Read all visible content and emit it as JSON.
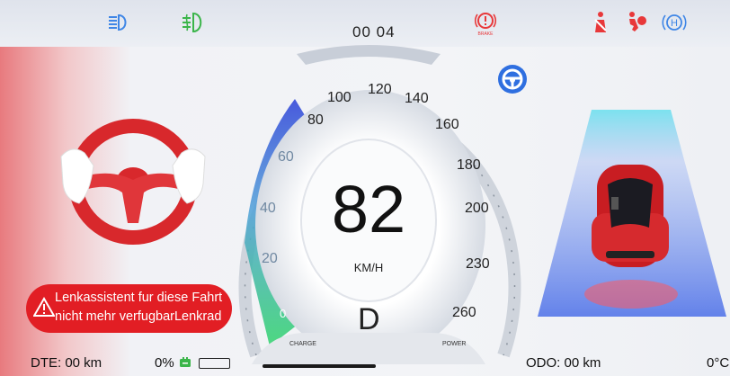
{
  "top_bar": {
    "clock": "00 04",
    "icons": [
      "low-beam-icon",
      "fog-light-icon",
      "brake-warning-icon",
      "seatbelt-warning-icon",
      "airbag-warning-icon",
      "hold-icon"
    ],
    "brake_label": "BRAKE",
    "hold_label": "H"
  },
  "speedometer": {
    "speed": "82",
    "unit": "KM/H",
    "gear": "D",
    "charge_label": "CHARGE",
    "power_label": "POWER",
    "ticks": [
      "0",
      "20",
      "40",
      "60",
      "80",
      "100",
      "120",
      "140",
      "160",
      "180",
      "200",
      "230",
      "260"
    ]
  },
  "steering_icon": "steering-wheel-icon",
  "warning": {
    "text": "Lenkassistent fur diese Fahrt\nnicht mehr verfugbarLenkrad",
    "icon": "warning-triangle-icon"
  },
  "bottom": {
    "dte": "DTE: 00 km",
    "battery_pct": "0%",
    "battery_fill": 0,
    "odo": "ODO: 00 km",
    "temp": "0°C"
  },
  "colors": {
    "accent_red": "#e21e24",
    "accent_blue": "#2f6fe0",
    "gauge_green": "#2fd36b",
    "lamp_green": "#3bb54a"
  }
}
